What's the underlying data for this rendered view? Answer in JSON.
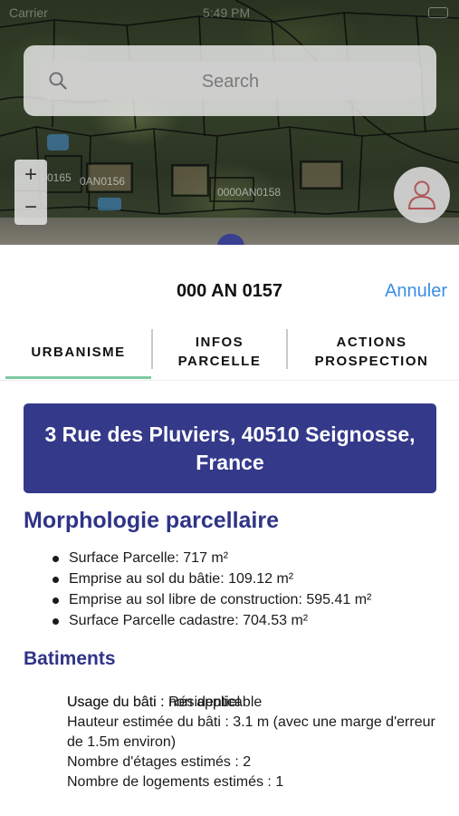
{
  "status_bar": {
    "carrier": "Carrier",
    "time": "5:49 PM"
  },
  "map": {
    "search_placeholder": "Search",
    "zoom_in": "+",
    "zoom_out": "−",
    "parcel_labels": [
      "0165",
      "0AN0156",
      "0000AN0158"
    ]
  },
  "sheet": {
    "title": "000 AN 0157",
    "cancel": "Annuler",
    "tabs": [
      {
        "line1": "URBANISME",
        "line2": ""
      },
      {
        "line1": "INFOS",
        "line2": "PARCELLE"
      },
      {
        "line1": "ACTIONS",
        "line2": "PROSPECTION"
      }
    ],
    "address": "3 Rue des Pluviers, 40510 Seignosse, France",
    "morphology": {
      "heading": "Morphologie parcellaire",
      "items": [
        "Surface Parcelle: 717 m²",
        "Emprise au sol du bâtie: 109.12 m²",
        "Emprise au sol libre de construction: 595.41 m²",
        "Surface Parcelle cadastre: 704.53 m²"
      ]
    },
    "batiments": {
      "heading": "Batiments",
      "lines": [
        "Usage du bâti : Résidentiel",
        "Hauteur estimée du bâti : 3.1 m (avec une marge d'erreur de 1.5m environ)",
        "Nombre d'étages estimés : 2",
        "Nombre de logements estimés : 1"
      ],
      "next_line": "Usage du bâti : non applicable"
    }
  },
  "colors": {
    "primary": "#34398a",
    "heading": "#2f3487",
    "link": "#3a8ee6",
    "tab_indicator": "#7cc9a3"
  }
}
